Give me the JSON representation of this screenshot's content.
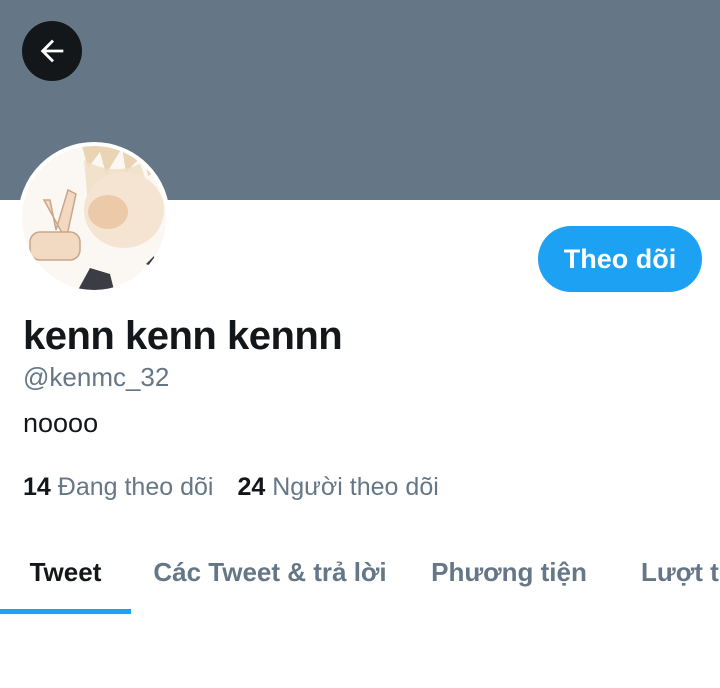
{
  "header": {
    "banner_color": "#657786",
    "back_icon": "arrow-left-icon"
  },
  "profile": {
    "avatar_icon": "avatar-image",
    "display_name": "kenn kenn kennn",
    "handle": "@kenmc_32",
    "bio": "noooo",
    "follow_label": "Theo dõi",
    "stats": {
      "following_count": "14",
      "following_label": "Đang theo dõi",
      "followers_count": "24",
      "followers_label": "Người theo dõi"
    }
  },
  "tabs": [
    {
      "label": "Tweet",
      "active": true
    },
    {
      "label": "Các Tweet & trả lời",
      "active": false
    },
    {
      "label": "Phương tiện",
      "active": false
    },
    {
      "label": "Lượt thích",
      "active": false
    }
  ],
  "colors": {
    "accent": "#1da1f2",
    "text": "#14171a",
    "secondary": "#657786"
  }
}
